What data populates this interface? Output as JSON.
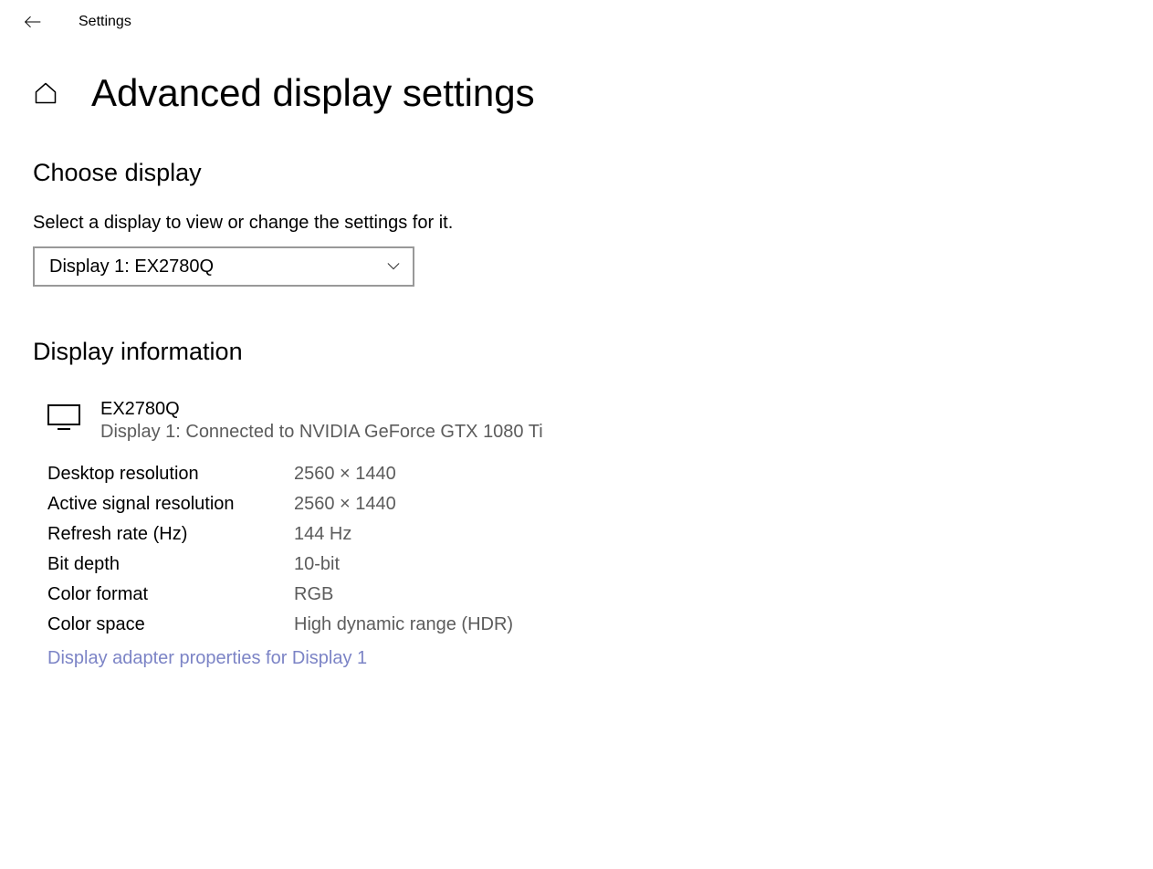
{
  "header": {
    "title": "Settings"
  },
  "page": {
    "title": "Advanced display settings"
  },
  "choose_display": {
    "heading": "Choose display",
    "description": "Select a display to view or change the settings for it.",
    "selected": "Display 1: EX2780Q"
  },
  "display_info": {
    "heading": "Display information",
    "name": "EX2780Q",
    "connection": "Display 1: Connected to NVIDIA GeForce GTX 1080 Ti",
    "specs": [
      {
        "label": "Desktop resolution",
        "value": "2560 × 1440"
      },
      {
        "label": "Active signal resolution",
        "value": "2560 × 1440"
      },
      {
        "label": "Refresh rate (Hz)",
        "value": "144 Hz"
      },
      {
        "label": "Bit depth",
        "value": "10-bit"
      },
      {
        "label": "Color format",
        "value": "RGB"
      },
      {
        "label": "Color space",
        "value": "High dynamic range (HDR)"
      }
    ],
    "adapter_link": "Display adapter properties for Display 1"
  }
}
